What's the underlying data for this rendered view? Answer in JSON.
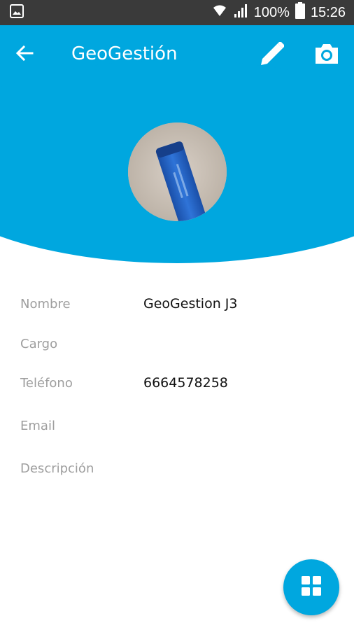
{
  "status_bar": {
    "battery": "100%",
    "time": "15:26"
  },
  "toolbar": {
    "title": "GeoGestión"
  },
  "profile": {
    "fields": [
      {
        "label": "Nombre",
        "value": "GeoGestion J3"
      },
      {
        "label": "Cargo",
        "value": ""
      },
      {
        "label": "Teléfono",
        "value": "6664578258"
      },
      {
        "label": "Email",
        "value": ""
      },
      {
        "label": "Descripción",
        "value": ""
      }
    ]
  },
  "colors": {
    "primary": "#00a7df",
    "status_bar": "#3a3a3a",
    "label": "#9e9e9e",
    "value": "#111111"
  },
  "icons": {
    "status": [
      "gallery-icon",
      "wifi-icon",
      "signal-icon",
      "battery-icon"
    ],
    "toolbar": [
      "back-arrow-icon",
      "pencil-icon",
      "camera-icon"
    ],
    "fab": "grid-icon"
  }
}
